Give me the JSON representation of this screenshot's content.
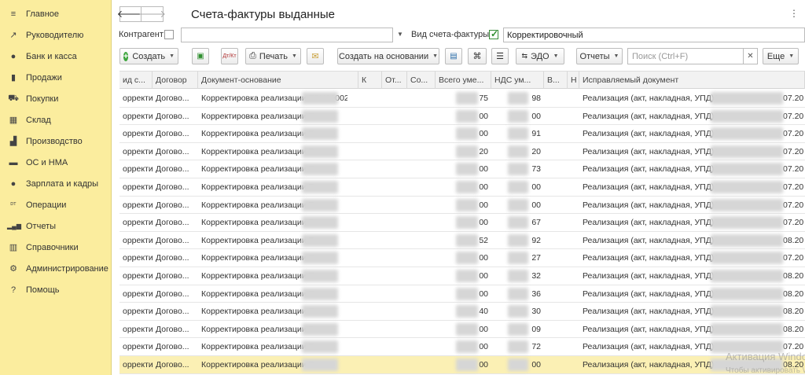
{
  "sidebar": {
    "items": [
      {
        "label": "Главное",
        "icon": "menu-icon",
        "glyph": "≡"
      },
      {
        "label": "Руководителю",
        "icon": "trend-icon",
        "glyph": "↗"
      },
      {
        "label": "Банк и касса",
        "icon": "coin-icon",
        "glyph": "●"
      },
      {
        "label": "Продажи",
        "icon": "bag-icon",
        "glyph": "▮"
      },
      {
        "label": "Покупки",
        "icon": "cart-icon",
        "glyph": "⛟"
      },
      {
        "label": "Склад",
        "icon": "warehouse-icon",
        "glyph": "▦"
      },
      {
        "label": "Производство",
        "icon": "factory-icon",
        "glyph": "▟"
      },
      {
        "label": "ОС и НМА",
        "icon": "truck-icon",
        "glyph": "▬"
      },
      {
        "label": "Зарплата и кадры",
        "icon": "person-icon",
        "glyph": "●"
      },
      {
        "label": "Операции",
        "icon": "dt-kt-icon",
        "glyph": "ᴰᵀ"
      },
      {
        "label": "Отчеты",
        "icon": "bar-chart-icon",
        "glyph": "▂▄▆"
      },
      {
        "label": "Справочники",
        "icon": "books-icon",
        "glyph": "▥"
      },
      {
        "label": "Администрирование",
        "icon": "gear-icon",
        "glyph": "⚙"
      },
      {
        "label": "Помощь",
        "icon": "question-icon",
        "glyph": "?"
      }
    ]
  },
  "header": {
    "title": "Счета-фактуры выданные",
    "back": "🡐",
    "forward": "🡒",
    "kebab": "⋮"
  },
  "filters": {
    "counterparty_label": "Контрагент:",
    "counterparty_value": "",
    "invoice_type_label": "Вид счета-фактуры:",
    "invoice_type_value": "Корректировочный"
  },
  "toolbar": {
    "create": "Создать",
    "print": "Печать",
    "create_based_on": "Создать на основании",
    "edo": "ЭДО",
    "reports": "Отчеты",
    "search_placeholder": "Поиск (Ctrl+F)",
    "more": "Еще",
    "dt_kt": "Дт/Кт"
  },
  "table": {
    "columns": [
      "ид с...",
      "Договор",
      "Документ-основание",
      "К",
      "От...",
      "Со...",
      "Всего уме...",
      "НДС ум...",
      "В...",
      "Н",
      "Исправляемый документ"
    ],
    "rows": [
      {
        "c0": "орректи...",
        "c1": "Догово...",
        "c2": "Корректировка реализации ТРМ00002...",
        "sum": "75",
        "vat": "98",
        "fix": "Реализация (акт, накладная, УПД) Т",
        "date": "07.20"
      },
      {
        "c0": "орректи...",
        "c1": "Догово...",
        "c2": "Корректировка реализации Т",
        "sum": "00",
        "vat": "00",
        "fix": "Реализация (акт, накладная, УПД) Т",
        "date": "07.20"
      },
      {
        "c0": "орректи...",
        "c1": "Догово...",
        "c2": "Корректировка реализации Т",
        "sum": "00",
        "vat": "91",
        "fix": "Реализация (акт, накладная, УПД) Т",
        "date": "07.20"
      },
      {
        "c0": "орректи...",
        "c1": "Догово...",
        "c2": "Корректировка реализации Т",
        "sum": "20",
        "vat": "20",
        "fix": "Реализация (акт, накладная, УПД) Т",
        "date": "07.20"
      },
      {
        "c0": "орректи...",
        "c1": "Догово...",
        "c2": "Корректировка реализации Т",
        "sum": "00",
        "vat": "73",
        "fix": "Реализация (акт, накладная, УПД) Т",
        "date": "07.20"
      },
      {
        "c0": "орректи...",
        "c1": "Догово...",
        "c2": "Корректировка реализации Т",
        "sum": "00",
        "vat": "00",
        "fix": "Реализация (акт, накладная, УПД) Т",
        "date": "07.20"
      },
      {
        "c0": "орректи...",
        "c1": "Догово...",
        "c2": "Корректировка реализации Т",
        "sum": "00",
        "vat": "00",
        "fix": "Реализация (акт, накладная, УПД) Т",
        "date": "07.20"
      },
      {
        "c0": "орректи...",
        "c1": "Догово...",
        "c2": "Корректировка реализации Т",
        "sum": "00",
        "vat": "67",
        "fix": "Реализация (акт, накладная, УПД) Т",
        "date": "07.20"
      },
      {
        "c0": "орректи...",
        "c1": "Догово...",
        "c2": "Корректировка реализации Т",
        "sum": "52",
        "vat": "92",
        "fix": "Реализация (акт, накладная, УПД) Т",
        "date": "08.20"
      },
      {
        "c0": "орректи...",
        "c1": "Догово...",
        "c2": "Корректировка реализации Т",
        "sum": "00",
        "vat": "27",
        "fix": "Реализация (акт, накладная, УПД) Т",
        "date": "07.20"
      },
      {
        "c0": "орректи...",
        "c1": "Догово...",
        "c2": "Корректировка реализации Т",
        "sum": "00",
        "vat": "32",
        "fix": "Реализация (акт, накладная, УПД) Т",
        "date": "08.20"
      },
      {
        "c0": "орректи...",
        "c1": "Догово...",
        "c2": "Корректировка реализации Т",
        "sum": "00",
        "vat": "36",
        "fix": "Реализация (акт, накладная, УПД) Т",
        "date": "08.20"
      },
      {
        "c0": "орректи...",
        "c1": "Догово...",
        "c2": "Корректировка реализации Т",
        "sum": "40",
        "vat": "30",
        "fix": "Реализация (акт, накладная, УПД) Т",
        "date": "08.20"
      },
      {
        "c0": "орректи...",
        "c1": "Догово...",
        "c2": "Корректировка реализации Т",
        "sum": "00",
        "vat": "09",
        "fix": "Реализация (акт, накладная, УПД) Т",
        "date": "08.20"
      },
      {
        "c0": "орректи...",
        "c1": "Догово...",
        "c2": "Корректировка реализации Т",
        "sum": "00",
        "vat": "72",
        "fix": "Реализация (акт, накладная, УПД) Т",
        "date": "07.20"
      },
      {
        "c0": "орректи...",
        "c1": "Догово...",
        "c2": "Корректировка реализации Т",
        "sum": "00",
        "vat": "00",
        "fix": "Реализация (акт, накладная, УПД) Т",
        "date": "08.20"
      }
    ]
  },
  "watermark": {
    "line1": "Активация Windo",
    "line2": "Чтобы активировать Windows, перейдите в"
  },
  "colors": {
    "sidebar_bg": "#fbed9e",
    "selected_row": "#fbf0b4",
    "checkbox_green": "#2f8f2f"
  }
}
